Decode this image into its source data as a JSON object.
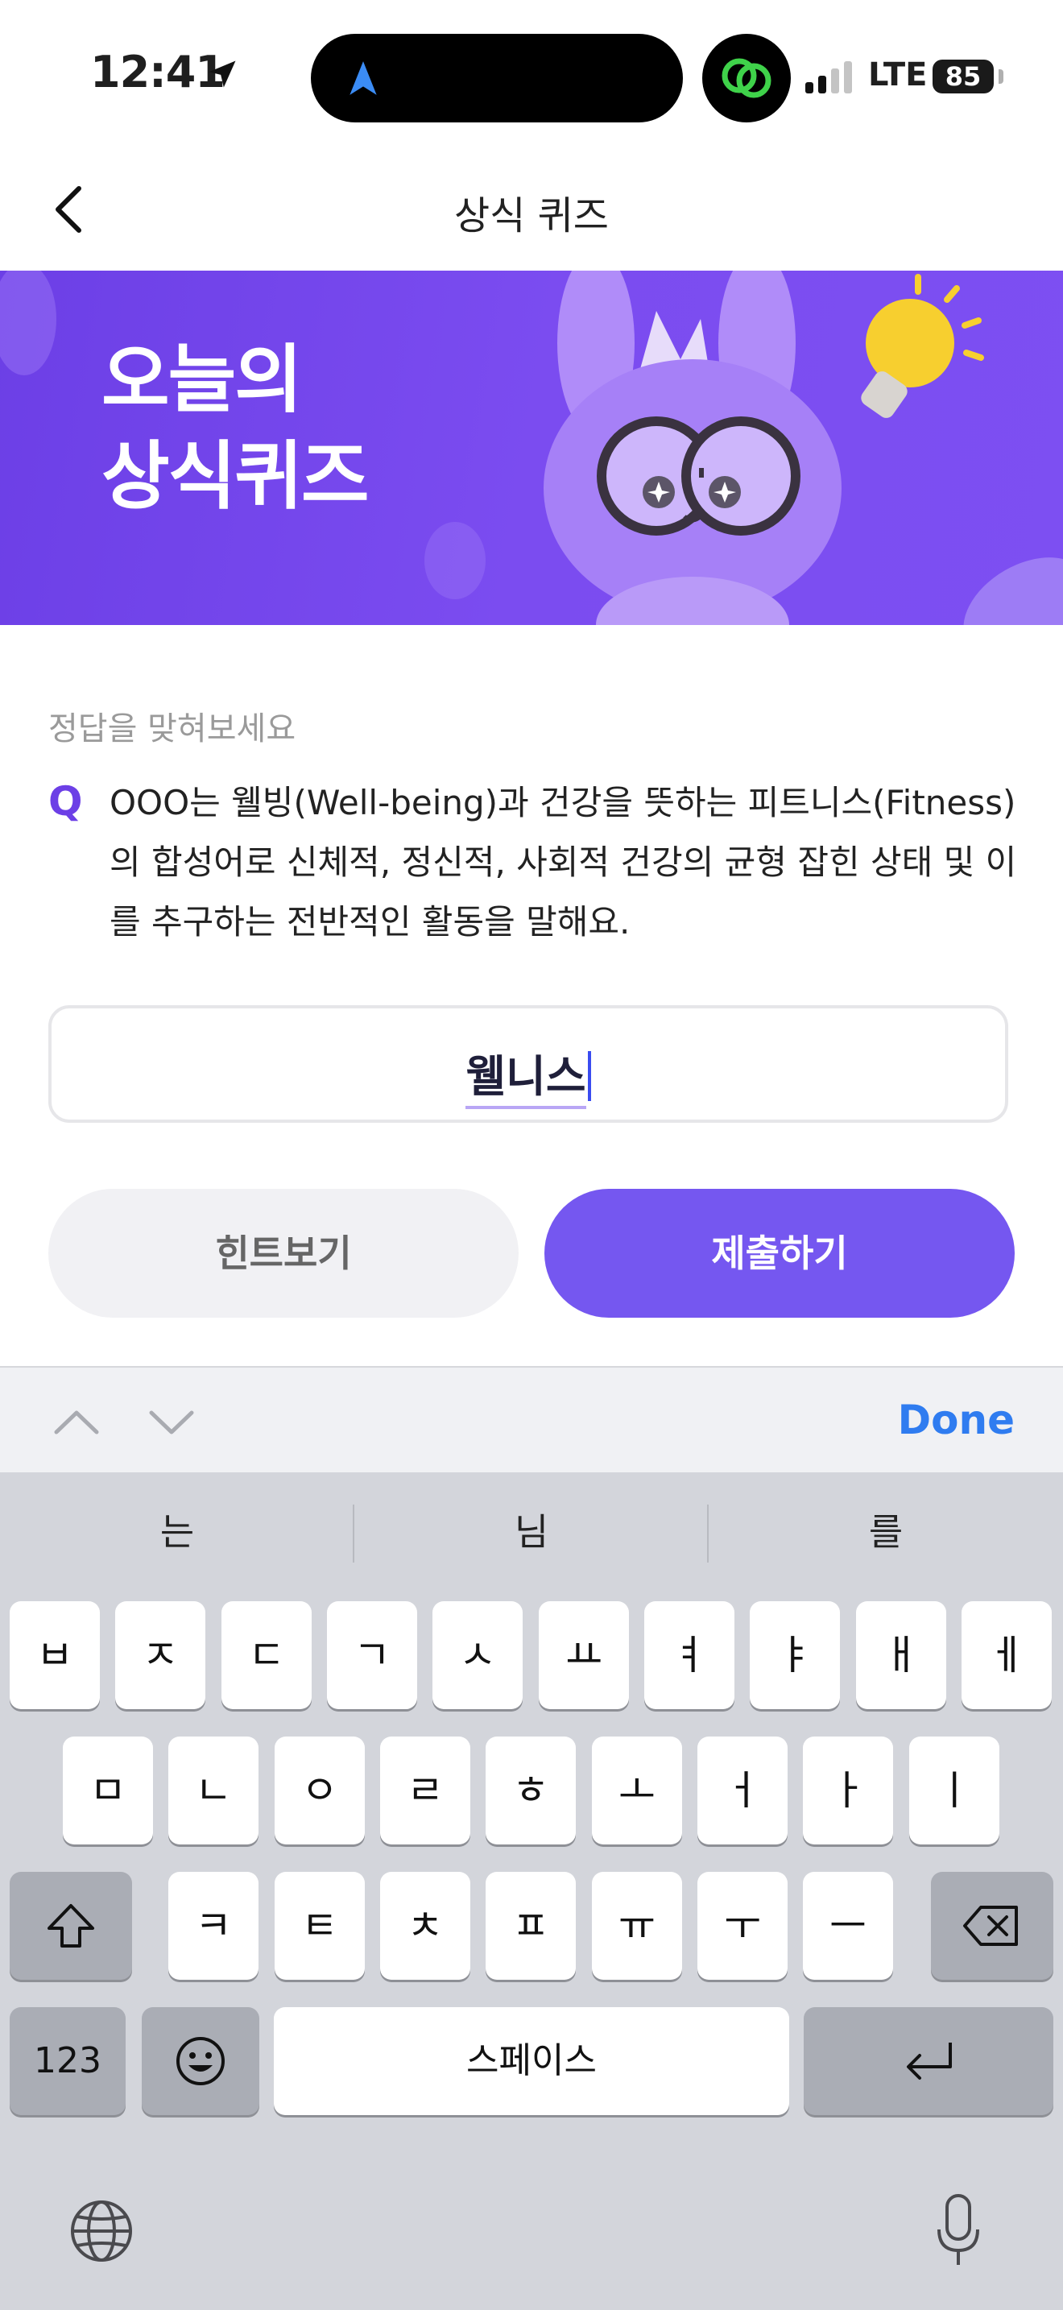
{
  "status_bar": {
    "time": "12:41",
    "network": "LTE",
    "battery": "85"
  },
  "nav": {
    "title": "상식 퀴즈"
  },
  "banner": {
    "title_line1": "오늘의",
    "title_line2": "상식퀴즈"
  },
  "quiz": {
    "hint_label": "정답을 맞혀보세요",
    "q_mark": "Q",
    "question": "OOO는 웰빙(Well-being)과 건강을 뜻하는 피트니스(Fitness)의 합성어로 신체적, 정신적, 사회적 건강의 균형 잡힌 상태 및 이를 추구하는 전반적인 활동을 말해요.",
    "answer_value": "웰니스"
  },
  "buttons": {
    "hint": "힌트보기",
    "submit": "제출하기"
  },
  "accessory": {
    "done": "Done"
  },
  "keyboard": {
    "suggestions": [
      "는",
      "님",
      "를"
    ],
    "row1": [
      "ㅂ",
      "ㅈ",
      "ㄷ",
      "ㄱ",
      "ㅅ",
      "ㅛ",
      "ㅕ",
      "ㅑ",
      "ㅐ",
      "ㅔ"
    ],
    "row2": [
      "ㅁ",
      "ㄴ",
      "ㅇ",
      "ㄹ",
      "ㅎ",
      "ㅗ",
      "ㅓ",
      "ㅏ",
      "ㅣ"
    ],
    "row3": [
      "ㅋ",
      "ㅌ",
      "ㅊ",
      "ㅍ",
      "ㅠ",
      "ㅜ",
      "ㅡ"
    ],
    "numbers_key": "123",
    "space_key": "스페이스",
    "icons": [
      "shift-icon",
      "backspace-icon",
      "emoji-icon",
      "return-icon",
      "globe-icon",
      "mic-icon"
    ]
  },
  "colors": {
    "accent": "#7557f0",
    "banner": "#7b4cf0",
    "done": "#2f7cf0"
  }
}
